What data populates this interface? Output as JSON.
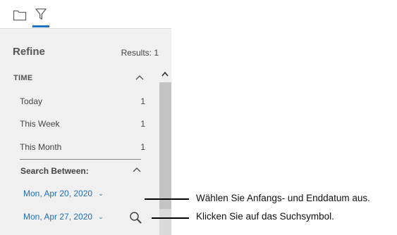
{
  "tabs": [
    {
      "icon": "folder-icon",
      "active": false
    },
    {
      "icon": "filter-icon",
      "active": true
    }
  ],
  "refine": {
    "title": "Refine",
    "results_label": "Results: 1"
  },
  "time_facet": {
    "header": "TIME",
    "items": [
      {
        "label": "Today",
        "count": "1"
      },
      {
        "label": "This Week",
        "count": "1"
      },
      {
        "label": "This Month",
        "count": "1"
      }
    ]
  },
  "search_between": {
    "label": "Search Between:",
    "start_date": "Mon, Apr 20, 2020",
    "end_date": "Mon, Apr 27, 2020"
  },
  "callouts": {
    "first": "Wählen Sie Anfangs- und Enddatum aus.",
    "second": "Klicken Sie auf das Suchsymbol."
  },
  "colors": {
    "accent": "#1f6fbf",
    "panel_bg": "#f0f0f0"
  }
}
